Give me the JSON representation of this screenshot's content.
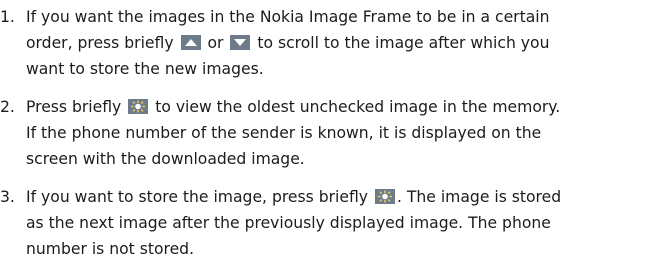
{
  "steps": [
    {
      "number": "1.",
      "lines": [
        [
          "If you want the images in the Nokia Image Frame to be in a certain"
        ],
        [
          "order, press briefly ",
          {
            "icon": "scroll-up-icon"
          },
          " or ",
          {
            "icon": "scroll-down-icon"
          },
          " to scroll to the image after which you"
        ],
        [
          "want to store the new images."
        ]
      ]
    },
    {
      "number": "2.",
      "lines": [
        [
          "Press briefly ",
          {
            "icon": "select-key-icon"
          },
          " to view the oldest unchecked image in the memory."
        ],
        [
          "If the phone number of the sender is known, it is displayed on the"
        ],
        [
          "screen with the downloaded image."
        ]
      ]
    },
    {
      "number": "3.",
      "lines": [
        [
          "If you want to store the image, press briefly ",
          {
            "icon": "select-key-icon"
          },
          ". The image is stored"
        ],
        [
          "as the next image after the previously displayed image. The phone"
        ],
        [
          "number is not stored."
        ]
      ]
    }
  ],
  "colors": {
    "text": "#1c1c1c",
    "icon_bg": "#6e7b8b",
    "icon_fg": "#ffffff",
    "icon_sun": "#f2d24a"
  }
}
